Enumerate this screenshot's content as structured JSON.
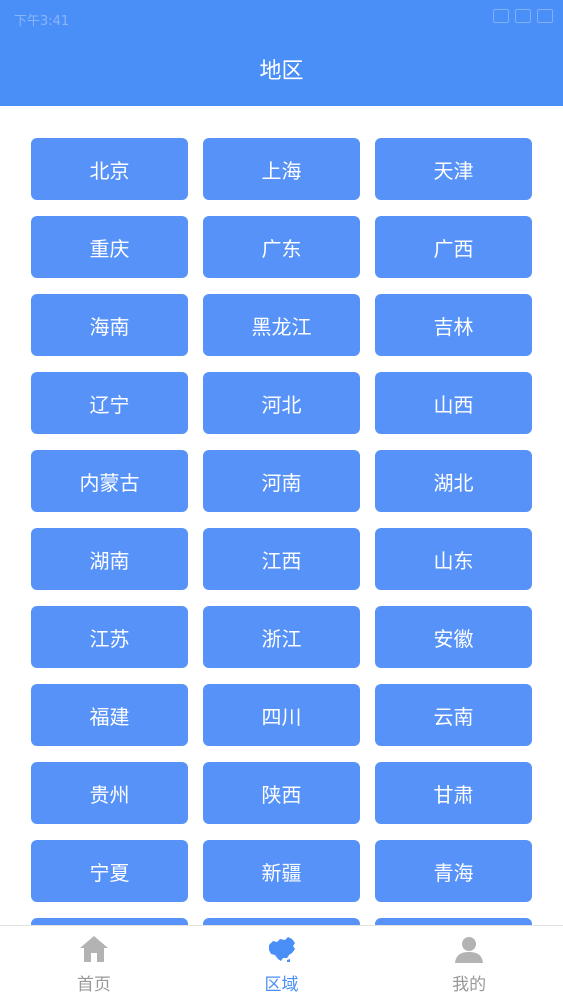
{
  "status_bar": {
    "time": "下午3:41"
  },
  "header": {
    "title": "地区"
  },
  "regions": [
    "北京",
    "上海",
    "天津",
    "重庆",
    "广东",
    "广西",
    "海南",
    "黑龙江",
    "吉林",
    "辽宁",
    "河北",
    "山西",
    "内蒙古",
    "河南",
    "湖北",
    "湖南",
    "江西",
    "山东",
    "江苏",
    "浙江",
    "安徽",
    "福建",
    "四川",
    "云南",
    "贵州",
    "陕西",
    "甘肃",
    "宁夏",
    "新疆",
    "青海",
    "",
    "",
    ""
  ],
  "tabs": {
    "home": {
      "label": "首页",
      "icon": "home-icon"
    },
    "region": {
      "label": "区域",
      "icon": "china-map-icon"
    },
    "mine": {
      "label": "我的",
      "icon": "user-icon"
    }
  },
  "colors": {
    "header_bg": "#4a8ef7",
    "button_bg": "#5792f8",
    "active_tab": "#4a8ef7",
    "inactive_tab": "#999999"
  }
}
